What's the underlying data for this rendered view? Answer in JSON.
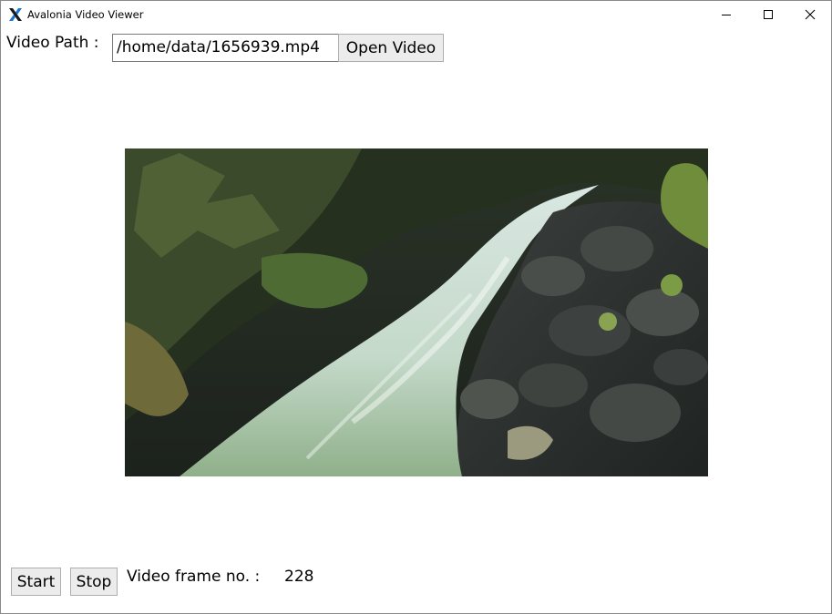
{
  "window": {
    "title": "Avalonia Video Viewer",
    "controls": {
      "minimize": "minimize-icon",
      "maximize": "maximize-icon",
      "close": "close-icon"
    }
  },
  "path_row": {
    "label": "Video Path :",
    "value": "/home/data/1656939.mp4",
    "open_button": "Open Video"
  },
  "video": {
    "description_icon": "video-frame-image"
  },
  "controls": {
    "start": "Start",
    "stop": "Stop",
    "frame_label": "Video frame no. :",
    "frame_value": "228"
  },
  "colors": {
    "accent_x_blue": "#1976d2",
    "accent_x_dark": "#1a1a1a"
  }
}
